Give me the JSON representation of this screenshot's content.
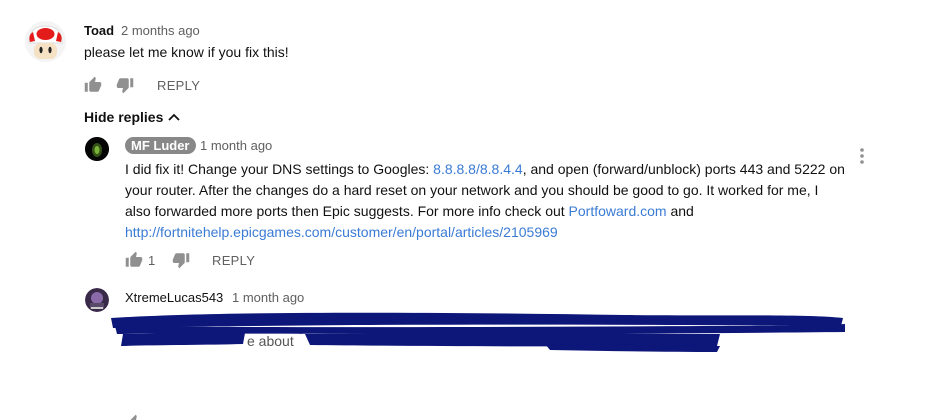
{
  "comments": [
    {
      "author": "Toad",
      "time": "2 months ago",
      "text": "please let me know if you fix this!",
      "reply_label": "REPLY",
      "hide_replies_label": "Hide replies"
    }
  ],
  "replies": [
    {
      "author": "MF Luder",
      "time": "1 month ago",
      "text_part1": "I did fix it! Change your DNS settings to Googles: ",
      "dns_link": "8.8.8.8/8.8.4.4",
      "text_part2": ", and open (forward/unblock) ports 443 and 5222 on",
      "line2": "your router. After the changes do a hard reset on your network and you should be good to go.  It worked for me, I",
      "line3_part1": "also forwarded more ports then Epic suggests.  For more info check out ",
      "portforward_link": "Portfoward.com",
      "line3_part2": " and",
      "url_link": "http://fortnitehelp.epicgames.com/customer/en/portal/articles/2105969",
      "like_count": "1",
      "reply_label": "REPLY"
    },
    {
      "author": "XtremeLucas543",
      "time": "1 month ago",
      "partial_text": "e about"
    }
  ],
  "colors": {
    "link": "#3a7bd5",
    "redaction": "#0d1679",
    "badge": "#888888"
  }
}
